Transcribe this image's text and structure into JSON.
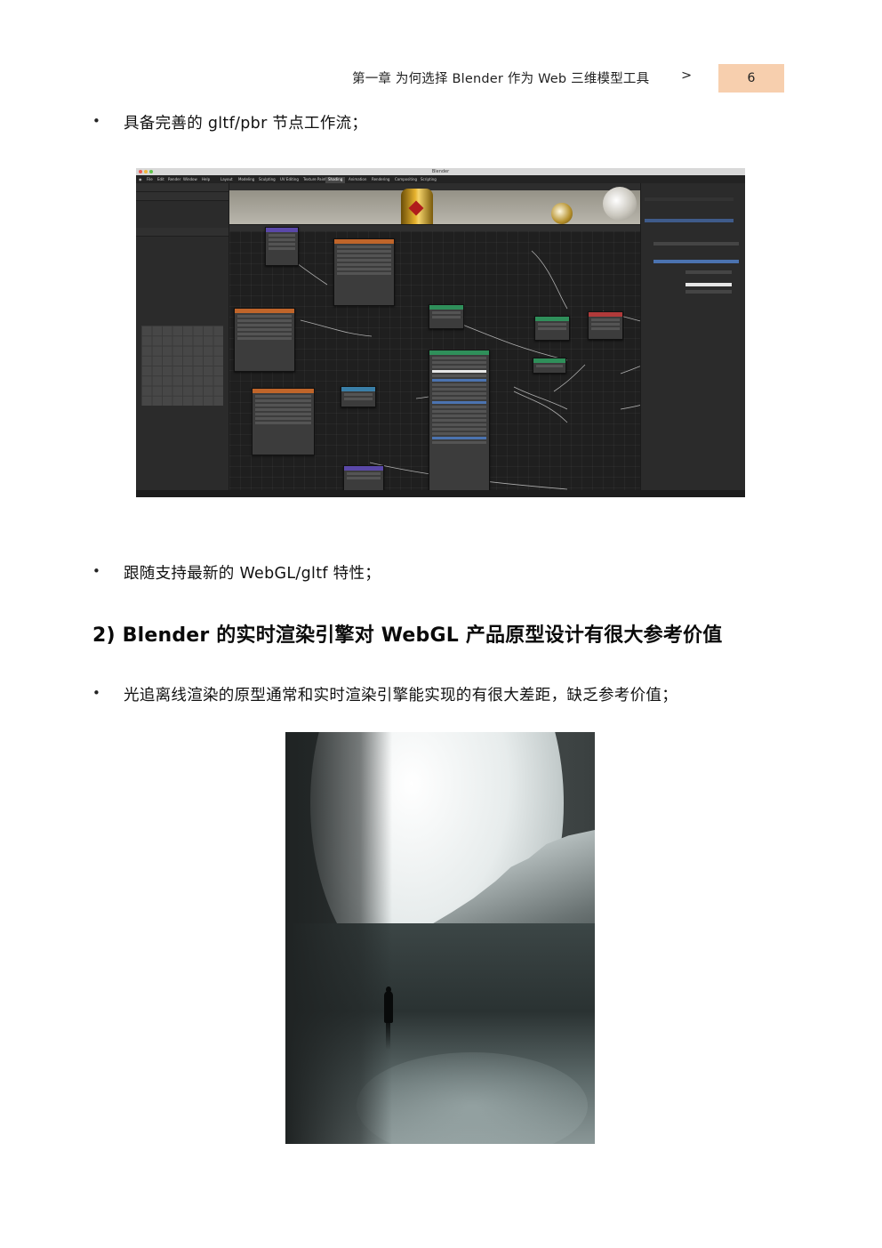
{
  "header": {
    "chapter_title": "第一章  为何选择 Blender 作为 Web 三维模型工具",
    "arrow": ">",
    "page_number": "6"
  },
  "bullets": [
    {
      "marker": "•",
      "text": "具备完善的 gltf/pbr 节点工作流；"
    },
    {
      "marker": "•",
      "text": "跟随支持最新的 WebGL/gltf 特性；"
    },
    {
      "marker": "•",
      "text": "光追离线渲染的原型通常和实时渲染引擎能实现的有很大差距，缺乏参考价值；"
    }
  ],
  "section": {
    "heading": "2)  Blender 的实时渲染引擎对 WebGL 产品原型设计有很大参考价值"
  },
  "figures": {
    "blender_screenshot": {
      "window_title": "Blender",
      "menu": [
        "File",
        "Edit",
        "Render",
        "Window",
        "Help"
      ],
      "workspaces": [
        "Layout",
        "Modeling",
        "Sculpting",
        "UV Editing",
        "Texture Paint",
        "Shading",
        "Animation",
        "Rendering",
        "Compositing",
        "Scripting"
      ],
      "active_workspace": "Shading",
      "colors": {
        "node_texture": "#c0652a",
        "node_shader": "#2f8f5a",
        "node_vector": "#5a48a8",
        "node_output": "#b03a3a",
        "node_converter": "#3a7fa8"
      }
    },
    "render_image": {
      "icon": "surreal-render-image"
    }
  }
}
